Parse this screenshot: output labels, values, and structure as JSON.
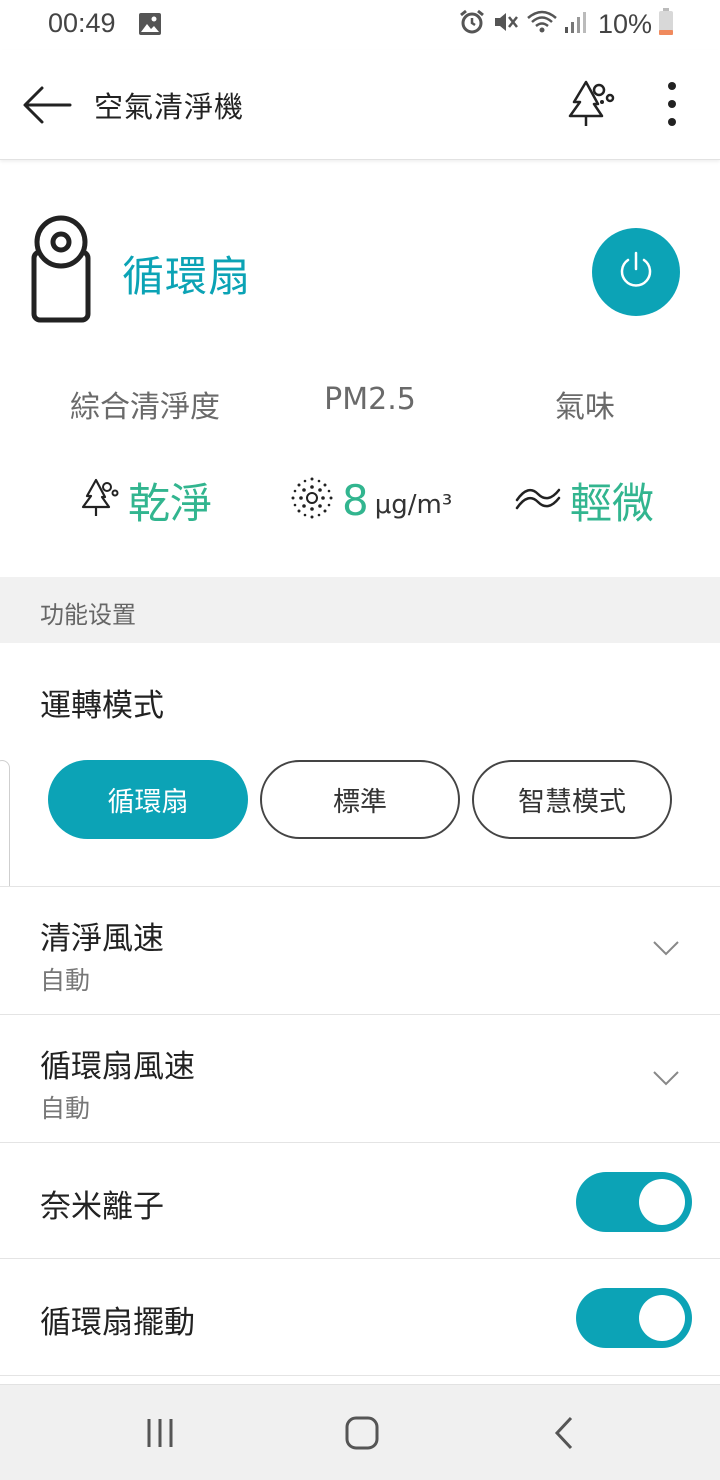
{
  "status_bar": {
    "time": "00:49",
    "battery_percent": "10%",
    "icons": [
      "gallery-icon",
      "alarm-icon",
      "mute-icon",
      "wifi-icon",
      "signal-icon",
      "battery-icon"
    ]
  },
  "app_bar": {
    "title": "空氣清淨機",
    "icons": [
      "back-arrow-icon",
      "tree-icon",
      "more-vert-icon"
    ]
  },
  "device": {
    "mode_name": "循環扇",
    "power_on": true
  },
  "indicators": [
    {
      "label": "綜合清淨度",
      "value": "乾淨",
      "unit": "",
      "icon": "tree-icon"
    },
    {
      "label": "PM2.5",
      "value": "8",
      "unit": "μg/m³",
      "icon": "particle-icon"
    },
    {
      "label": "氣味",
      "value": "輕微",
      "unit": "",
      "icon": "odor-waves-icon"
    }
  ],
  "section_title": "功能设置",
  "run_mode": {
    "label": "運轉模式",
    "options": [
      "循環扇",
      "標準",
      "智慧模式"
    ],
    "selected": "循環扇"
  },
  "settings": {
    "clean_speed": {
      "title": "清淨風速",
      "value": "自動"
    },
    "fan_speed": {
      "title": "循環扇風速",
      "value": "自動"
    },
    "nano_ion": {
      "title": "奈米離子",
      "on": true
    },
    "fan_swing": {
      "title": "循環扇擺動",
      "on": true
    }
  },
  "colors": {
    "accent": "#0ca3b6",
    "indicator_green": "#32b58f",
    "section_bg": "#f1f1f1"
  },
  "nav_bar": {
    "icons": [
      "recent-apps-icon",
      "home-icon",
      "back-icon"
    ]
  }
}
